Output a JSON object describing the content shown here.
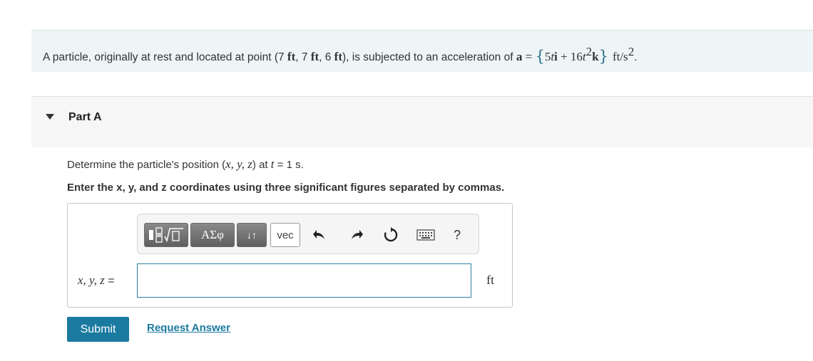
{
  "problem": {
    "text_1": "A particle, originally at rest and located at point (7 ",
    "unit_ft": "ft",
    "sep_1": ", 7 ",
    "sep_2": ", 6 ",
    "text_2": "), is subjected to an acceleration of ",
    "accel_symbol": "a",
    "equals": " = ",
    "brace_open": "{",
    "term_1_coef": "5",
    "term_1_var": "t",
    "term_1_unit": "i",
    "plus": " + ",
    "term_2_coef": "16",
    "term_2_var": "t",
    "term_2_exp": "2",
    "term_2_unit": "k",
    "brace_close": "}",
    "accel_unit": "ft/s",
    "accel_unit_exp": "2",
    "period": "."
  },
  "part": {
    "title": "Part A",
    "question_1": "Determine the particle's position (",
    "question_vars": "x, y, z",
    "question_2": ") at ",
    "question_t": "t",
    "question_3": " = 1 s.",
    "instruction": "Enter the x, y, and z coordinates using three significant figures separated by commas."
  },
  "toolbar": {
    "templates_icon": "fraction-sqrt-template-icon",
    "greek_label": "ΑΣφ",
    "arrows_label": "↓↑",
    "vec_label": "vec",
    "undo_icon": "undo-icon",
    "redo_icon": "redo-icon",
    "reset_icon": "reset-icon",
    "keyboard_icon": "keyboard-icon",
    "help_label": "?"
  },
  "answer": {
    "label_vars": "x, y, z",
    "label_eq": " =",
    "value": "",
    "placeholder": "",
    "unit": "ft"
  },
  "actions": {
    "submit_label": "Submit",
    "request_label": "Request Answer"
  },
  "colors": {
    "accent": "#1b7aa0",
    "problem_bg": "#eef5f7",
    "part_header_bg": "#f6f6f6"
  }
}
